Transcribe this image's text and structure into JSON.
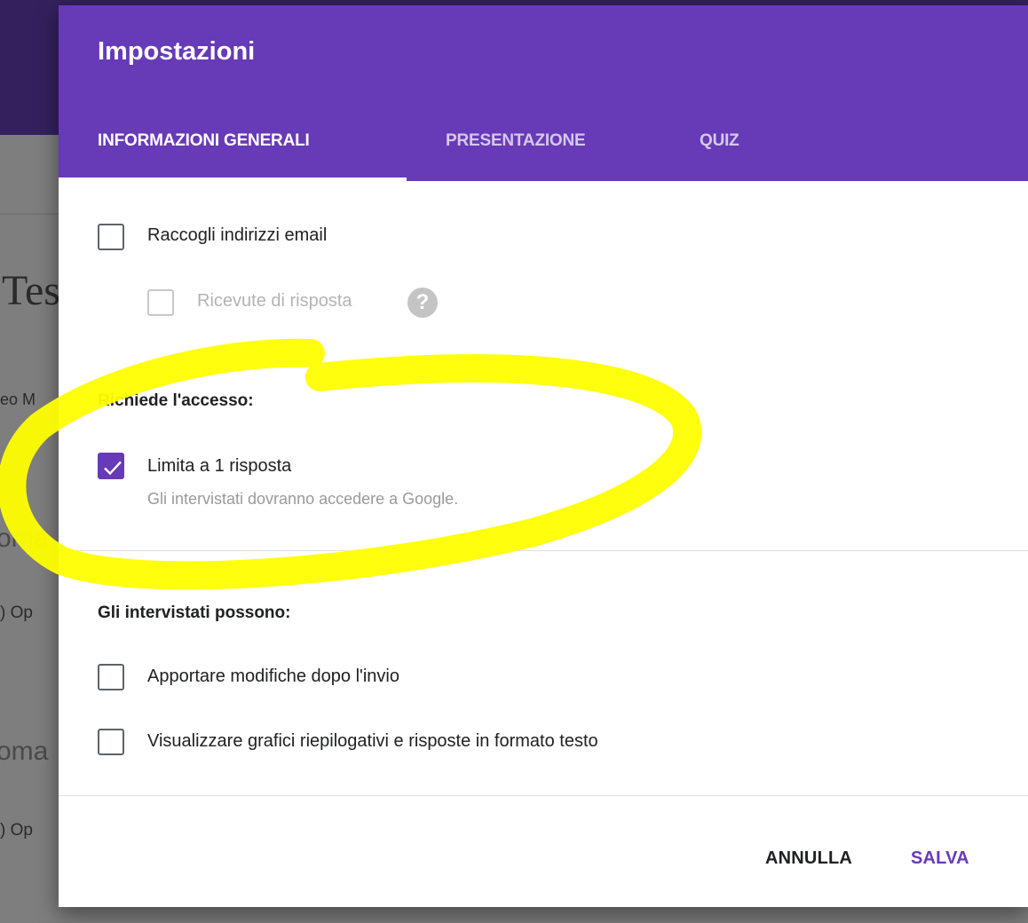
{
  "background": {
    "title_fragment": "Tes",
    "subtitle_fragment": "eo M",
    "question1_fragment": "oma",
    "option1_fragment": ") Op",
    "question2_fragment": "oma",
    "option2_fragment": ") Op"
  },
  "dialog": {
    "title": "Impostazioni",
    "tabs": [
      {
        "label": "INFORMAZIONI GENERALI",
        "active": true
      },
      {
        "label": "PRESENTAZIONE",
        "active": false
      },
      {
        "label": "QUIZ",
        "active": false
      }
    ],
    "collect_email": {
      "label": "Raccogli indirizzi email",
      "checked": false
    },
    "response_receipts": {
      "label": "Ricevute di risposta",
      "checked": false,
      "disabled": true,
      "help_icon": "help-circle-icon",
      "help_glyph": "?"
    },
    "requires_signin": {
      "heading": "Richiede l'accesso:",
      "limit_one": {
        "label": "Limita a 1 risposta",
        "helper": "Gli intervistati dovranno accedere a Google.",
        "checked": true
      }
    },
    "respondents_can": {
      "heading": "Gli intervistati possono:",
      "edit_after_submit": {
        "label": "Apportare modifiche dopo l'invio",
        "checked": false
      },
      "see_summary": {
        "label": "Visualizzare grafici riepilogativi e risposte in formato testo",
        "checked": false
      }
    },
    "actions": {
      "cancel": "ANNULLA",
      "save": "SALVA"
    }
  },
  "colors": {
    "accent": "#673ab7",
    "highlight": "#ffff00"
  }
}
